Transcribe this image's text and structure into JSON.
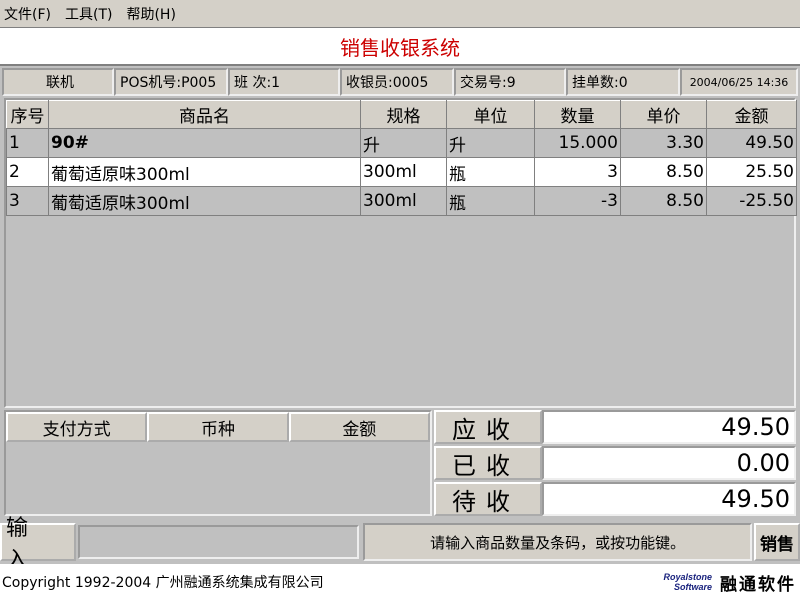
{
  "menu": [
    {
      "label": "文件(F)"
    },
    {
      "label": "工具(T)"
    },
    {
      "label": "帮助(H)"
    }
  ],
  "title": "销售收银系统",
  "status": {
    "online": "联机",
    "pos": "POS机号:P005",
    "shift": "班 次:1",
    "cashier": "收银员:0005",
    "txn": "交易号:9",
    "held": "挂单数:0",
    "datetime": "2004/06/25 14:36"
  },
  "table": {
    "headers": [
      "序号",
      "商品名",
      "规格",
      "单位",
      "数量",
      "单价",
      "金额"
    ],
    "rows": [
      {
        "no": "1",
        "name": "90#",
        "spec": "升",
        "unit": "升",
        "qty": "15.000",
        "price": "3.30",
        "amount": "49.50"
      },
      {
        "no": "2",
        "name": "葡萄适原味300ml",
        "spec": "300ml",
        "unit": "瓶",
        "qty": "3",
        "price": "8.50",
        "amount": "25.50"
      },
      {
        "no": "3",
        "name": "葡萄适原味300ml",
        "spec": "300ml",
        "unit": "瓶",
        "qty": "-3",
        "price": "8.50",
        "amount": "-25.50"
      }
    ]
  },
  "payment": {
    "headers": [
      "支付方式",
      "币种",
      "金额"
    ]
  },
  "totals": {
    "due_label": "应收",
    "due_value": "49.50",
    "paid_label": "已收",
    "paid_value": "0.00",
    "remain_label": "待收",
    "remain_value": "49.50"
  },
  "input": {
    "label": "输入",
    "value": "",
    "hint": "请输入商品数量及条码，或按功能键。",
    "mode": "销售"
  },
  "footer": {
    "copyright": "Copyright 1992-2004 广州融通系统集成有限公司",
    "logo_en_1": "Royalstone",
    "logo_en_2": "Software",
    "logo_cn": "融通软件"
  }
}
